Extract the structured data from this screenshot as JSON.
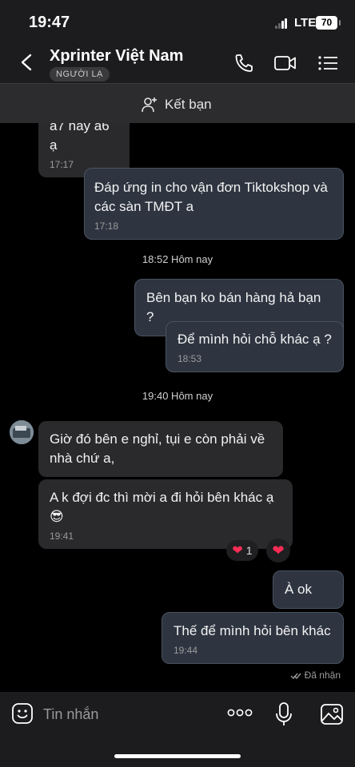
{
  "status_bar": {
    "time": "19:47",
    "network": "LTE",
    "battery": "70"
  },
  "header": {
    "title": "Xprinter Việt Nam",
    "badge": "NGƯỜI LẠ"
  },
  "add_friend": {
    "label": "Kết bạn"
  },
  "messages": [
    {
      "text": "a7 hay a6 ạ",
      "time": "17:17",
      "direction": "incoming"
    },
    {
      "text": "Đáp ứng in cho vận đơn Tiktokshop và các sàn TMĐT a",
      "time": "17:18",
      "direction": "outgoing"
    },
    {
      "text": "Bên bạn ko bán hàng hả bạn ?",
      "direction": "outgoing"
    },
    {
      "text": "Để mình hỏi chỗ khác ạ ?",
      "time": "18:53",
      "direction": "outgoing"
    },
    {
      "text": "Giờ đó bên e nghỉ, tụi e còn phải về nhà chứ a,",
      "direction": "incoming"
    },
    {
      "text": "A k đợi đc thì mời a đi hỏi bên khác ạ",
      "emoji": "😎",
      "time": "19:41",
      "direction": "incoming"
    },
    {
      "text": "À ok",
      "direction": "outgoing"
    },
    {
      "text": "Thế để mình hỏi bên khác",
      "time": "19:44",
      "direction": "outgoing"
    }
  ],
  "separators": [
    "18:52 Hôm nay",
    "19:40 Hôm nay"
  ],
  "reactions": {
    "count": "1"
  },
  "delivery_status": "Đã nhận",
  "input": {
    "placeholder": "Tin nhắn"
  },
  "colors": {
    "accent_heart": "#ff2d55",
    "outgoing_bubble": "#2e3541",
    "incoming_bubble": "#2a2a2c"
  },
  "icons": [
    "back-icon",
    "phone-icon",
    "video-call-icon",
    "menu-icon",
    "add-friend-icon",
    "emoji-icon",
    "more-icon",
    "microphone-icon",
    "image-icon",
    "double-check-icon",
    "heart-icon"
  ]
}
